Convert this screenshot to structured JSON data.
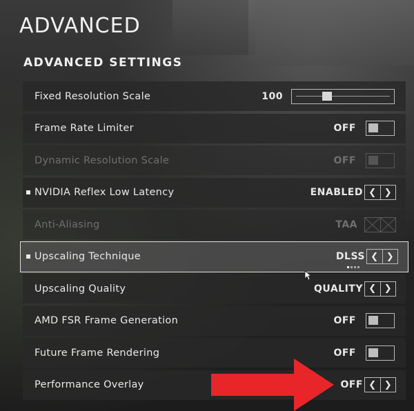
{
  "page_title": "ADVANCED",
  "section_title": "ADVANCED SETTINGS",
  "settings": [
    {
      "label": "Fixed Resolution Scale",
      "value": "100",
      "control": "slider",
      "slider_fraction": 0.32,
      "enabled": true,
      "bullet": false,
      "selected": false
    },
    {
      "label": "Frame Rate Limiter",
      "value": "OFF",
      "control": "toggle",
      "enabled": true,
      "bullet": false,
      "selected": false
    },
    {
      "label": "Dynamic Resolution Scale",
      "value": "OFF",
      "control": "toggle",
      "enabled": false,
      "bullet": false,
      "selected": false
    },
    {
      "label": "NVIDIA Reflex Low Latency",
      "value": "ENABLED",
      "control": "stepper",
      "enabled": true,
      "bullet": true,
      "selected": false
    },
    {
      "label": "Anti-Aliasing",
      "value": "TAA",
      "control": "grid",
      "enabled": false,
      "bullet": false,
      "selected": false
    },
    {
      "label": "Upscaling Technique",
      "value": "DLSS",
      "control": "stepper",
      "enabled": true,
      "bullet": true,
      "selected": true
    },
    {
      "label": "Upscaling Quality",
      "value": "QUALITY",
      "control": "stepper",
      "enabled": true,
      "bullet": false,
      "selected": false
    },
    {
      "label": "AMD FSR Frame Generation",
      "value": "OFF",
      "control": "toggle",
      "enabled": true,
      "bullet": false,
      "selected": false
    },
    {
      "label": "Future Frame Rendering",
      "value": "OFF",
      "control": "toggle",
      "enabled": true,
      "bullet": false,
      "selected": false
    },
    {
      "label": "Performance Overlay",
      "value": "OFF",
      "control": "stepper",
      "enabled": true,
      "bullet": false,
      "selected": false
    }
  ],
  "stepper_glyphs": {
    "prev": "❮",
    "next": "❯"
  },
  "colors": {
    "highlight_arrow": "#e8262a",
    "row_bg": "#282828",
    "text": "#eaeaea"
  }
}
